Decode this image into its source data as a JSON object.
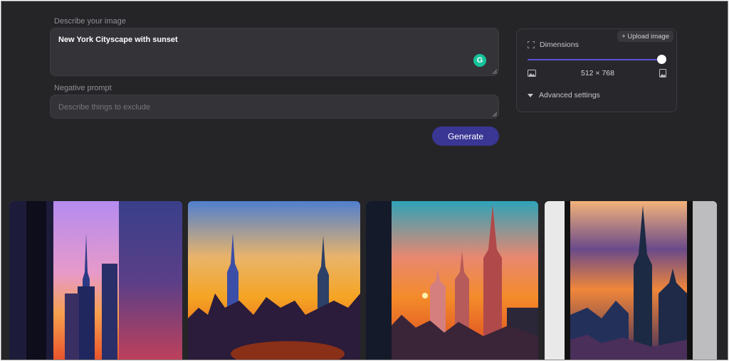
{
  "prompt": {
    "label": "Describe your image",
    "value": "New York Cityscape with sunset"
  },
  "negative_prompt": {
    "label": "Negative prompt",
    "placeholder": "Describe things to exclude"
  },
  "generate_label": "Generate",
  "grammarly_label": "G",
  "settings": {
    "upload_label": "+ Upload image",
    "dimensions_label": "Dimensions",
    "size_value": "512 × 768",
    "advanced_label": "Advanced settings"
  },
  "gallery": [
    {
      "icon": "generated-image-1"
    },
    {
      "icon": "generated-image-2"
    },
    {
      "icon": "generated-image-3"
    },
    {
      "icon": "generated-image-4"
    }
  ],
  "colors": {
    "background": "#252528",
    "field": "#343438",
    "accent": "#3a3694",
    "slider": "#5a52d6",
    "grammarly": "#15c39a"
  }
}
